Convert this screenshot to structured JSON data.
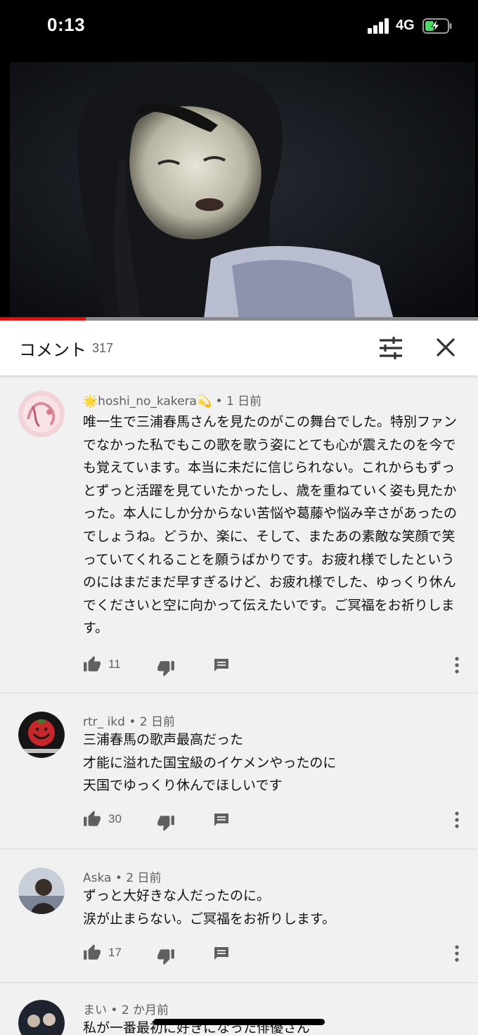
{
  "status_bar": {
    "time": "0:13",
    "network": "4G",
    "battery_charging": true
  },
  "video": {
    "progress_percent": 18,
    "progress_color": "#ff0000"
  },
  "comments_header": {
    "title": "コメント",
    "count": "317",
    "filter_icon": "sliders-icon",
    "close_icon": "close-icon"
  },
  "comments": [
    {
      "author": "🌟hoshi_no_kakera💫",
      "time": "• 1 日前",
      "text": "唯一生で三浦春馬さんを見たのがこの舞台でした。特別ファンでなかった私でもこの歌を歌う姿にとても心が震えたのを今でも覚えています。本当に未だに信じられない。これからもずっとずっと活躍を見ていたかったし、歳を重ねていく姿も見たかった。本人にしか分からない苦悩や葛藤や悩み辛さがあったのでしょうね。どうか、楽に、そして、またあの素敵な笑顔で笑っていてくれることを願うばかりです。お疲れ様でしたというのにはまだまだ早すぎるけど、お疲れ様でした、ゆっくり休んでくださいと空に向かって伝えたいです。ご冥福をお祈りします。",
      "likes": "11"
    },
    {
      "author": "rtr_ ikd",
      "time": "• 2 日前",
      "text": "三浦春馬の歌声最高だった\n才能に溢れた国宝級のイケメンやったのに\n天国でゆっくり休んでほしいです",
      "likes": "30"
    },
    {
      "author": "Aska",
      "time": "• 2 日前",
      "text": "ずっと大好きな人だったのに。\n涙が止まらない。ご冥福をお祈りします。",
      "likes": "17"
    },
    {
      "author": "まい",
      "time": "• 2 か月前",
      "text": "私が一番最初に好きになった俳優さん",
      "likes": ""
    }
  ],
  "icons": {
    "like": "thumbs-up-icon",
    "dislike": "thumbs-down-icon",
    "reply": "reply-icon",
    "more": "more-vert-icon"
  }
}
